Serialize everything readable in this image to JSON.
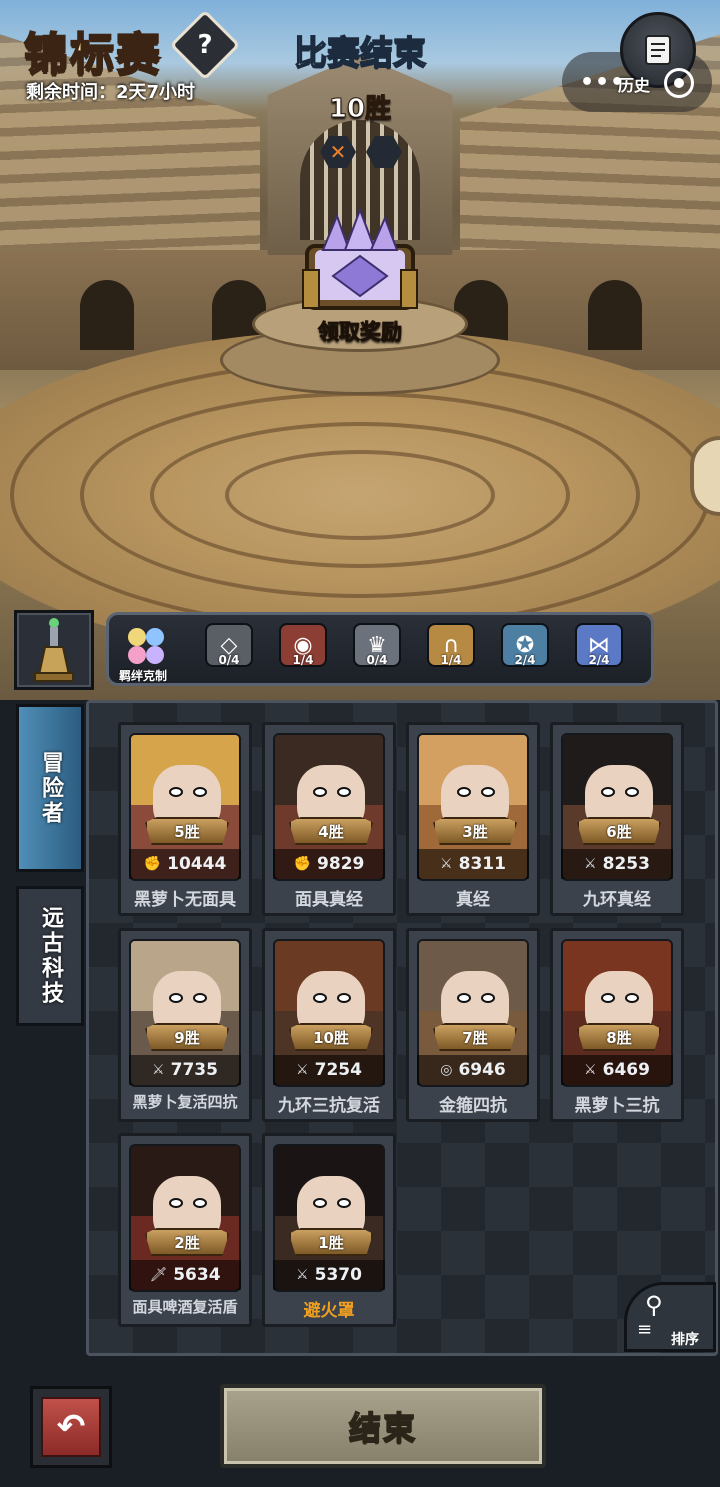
{
  "header": {
    "title": "锦标赛",
    "help_symbol": "?",
    "time_label": "剩余时间：",
    "time_value": "2天7小时",
    "history_label": "历史",
    "more_symbol": "•••"
  },
  "match": {
    "status": "比赛结束",
    "wins_text": "10胜",
    "results": [
      {
        "icon": "x-mark-icon",
        "symbol": "✕",
        "color": "#f0802a"
      },
      {
        "icon": "empty-slot-icon",
        "symbol": "",
        "color": "#8aa0b8"
      }
    ],
    "claim_label": "领取奖励"
  },
  "synergy": {
    "bond_label": "羁绊克制",
    "items": [
      {
        "icon": "diamond-icon",
        "symbol": "◇",
        "count": "0/4",
        "color": "#5a5f66"
      },
      {
        "icon": "eye-icon",
        "symbol": "◉",
        "count": "1/4",
        "color": "#8c3e34"
      },
      {
        "icon": "crown-icon",
        "symbol": "♛",
        "count": "0/4",
        "color": "#6c727b"
      },
      {
        "icon": "flame-icon",
        "symbol": "∩",
        "count": "1/4",
        "color": "#b78a43"
      },
      {
        "icon": "shield-icon",
        "symbol": "✪",
        "count": "2/4",
        "color": "#4d7fa3"
      },
      {
        "icon": "banner-icon",
        "symbol": "⋈",
        "count": "2/4",
        "color": "#5b79c4"
      }
    ]
  },
  "tabs": [
    {
      "label": "冒险者",
      "active": true
    },
    {
      "label": "远古科技",
      "active": false
    }
  ],
  "heroes": [
    {
      "wins": "5胜",
      "power": "10444",
      "name": "黑萝卜无面具",
      "stat_icon": "fist-icon",
      "hair": "#d6a44a",
      "bg": "#8a4b3a"
    },
    {
      "wins": "4胜",
      "power": "9829",
      "name": "面具真经",
      "stat_icon": "fist-icon",
      "hair": "#3b2a22",
      "bg": "#6e3a2b"
    },
    {
      "wins": "3胜",
      "power": "8311",
      "name": "真经",
      "stat_icon": "sword-icon",
      "hair": "#d4a062",
      "bg": "#a0693a"
    },
    {
      "wins": "6胜",
      "power": "8253",
      "name": "九环真经",
      "stat_icon": "sword-icon",
      "hair": "#1f1b1a",
      "bg": "#5a3a2a"
    },
    {
      "wins": "9胜",
      "power": "7735",
      "name": "黑萝卜复活四抗",
      "stat_icon": "sword-icon",
      "hair": "#b9a68a",
      "bg": "#6a5a4c"
    },
    {
      "wins": "10胜",
      "power": "7254",
      "name": "九环三抗复活",
      "stat_icon": "sword-icon",
      "hair": "#6a3b22",
      "bg": "#4e3424"
    },
    {
      "wins": "7胜",
      "power": "6946",
      "name": "金箍四抗",
      "stat_icon": "target-icon",
      "hair": "#6e5a48",
      "bg": "#7a5a3c"
    },
    {
      "wins": "8胜",
      "power": "6469",
      "name": "黑萝卜三抗",
      "stat_icon": "sword-icon",
      "hair": "#7a3520",
      "bg": "#5c2a1e"
    },
    {
      "wins": "2胜",
      "power": "5634",
      "name": "面具啤酒复活盾",
      "stat_icon": "dagger-icon",
      "hair": "#2a1a16",
      "bg": "#6a2a22"
    },
    {
      "wins": "1胜",
      "power": "5370",
      "name": "避火罩",
      "stat_icon": "sword-icon",
      "hair": "#1a1414",
      "bg": "#3a2a22",
      "name_color": "gold"
    }
  ],
  "sort": {
    "label": "排序"
  },
  "footer": {
    "back_symbol": "↶",
    "end_label": "结束"
  }
}
